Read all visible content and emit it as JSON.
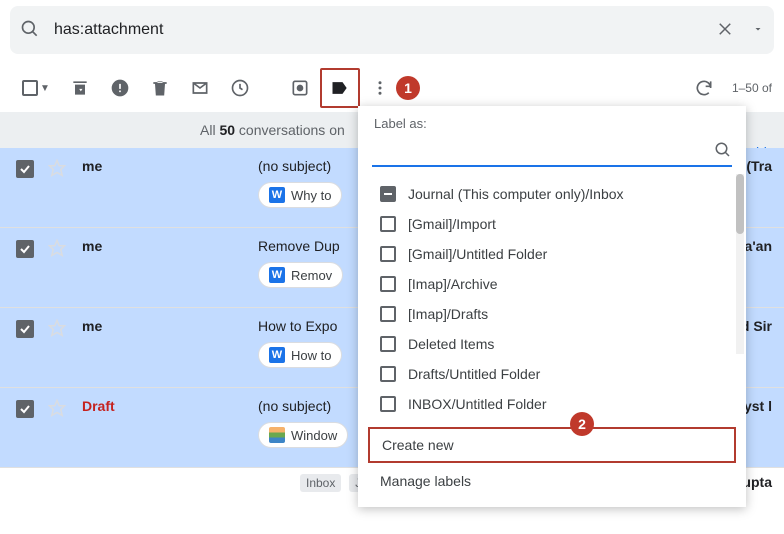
{
  "search": {
    "query": "has:attachment"
  },
  "toolbar": {
    "count_text": "1–50 of"
  },
  "conv_header": {
    "prefix": "All ",
    "count": "50",
    "suffix": " conversations on ",
    "link_fragment": "his s"
  },
  "rows": [
    {
      "sender": "me",
      "subject": "(no subject)",
      "chip": "Why to",
      "tail": "(Tra",
      "chip_type": "w"
    },
    {
      "sender": "me",
      "subject": "Remove Dup",
      "chip": "Remov",
      "tail": "Ma'an",
      "chip_type": "w"
    },
    {
      "sender": "me",
      "subject": "How to Expo",
      "chip": "How to",
      "tail": "d Sir",
      "chip_type": "w"
    },
    {
      "sender": "Draft",
      "subject": "(no subject)",
      "chip": "Window",
      "tail": "yst l",
      "chip_type": "sq",
      "draft": true
    }
  ],
  "bottom_labels": [
    "Inbox",
    "Journ"
  ],
  "bottom_tail": "Gupta",
  "dropdown": {
    "title": "Label as:",
    "search_value": "",
    "options": [
      {
        "label": "Journal (This computer only)/Inbox",
        "state": "ind"
      },
      {
        "label": "[Gmail]/Import",
        "state": "off"
      },
      {
        "label": "[Gmail]/Untitled Folder",
        "state": "off"
      },
      {
        "label": "[Imap]/Archive",
        "state": "off"
      },
      {
        "label": "[Imap]/Drafts",
        "state": "off"
      },
      {
        "label": "Deleted Items",
        "state": "off"
      },
      {
        "label": "Drafts/Untitled Folder",
        "state": "off"
      },
      {
        "label": "INBOX/Untitled Folder",
        "state": "off"
      }
    ],
    "create": "Create new",
    "manage": "Manage labels"
  },
  "annotations": {
    "b1": "1",
    "b2": "2"
  }
}
